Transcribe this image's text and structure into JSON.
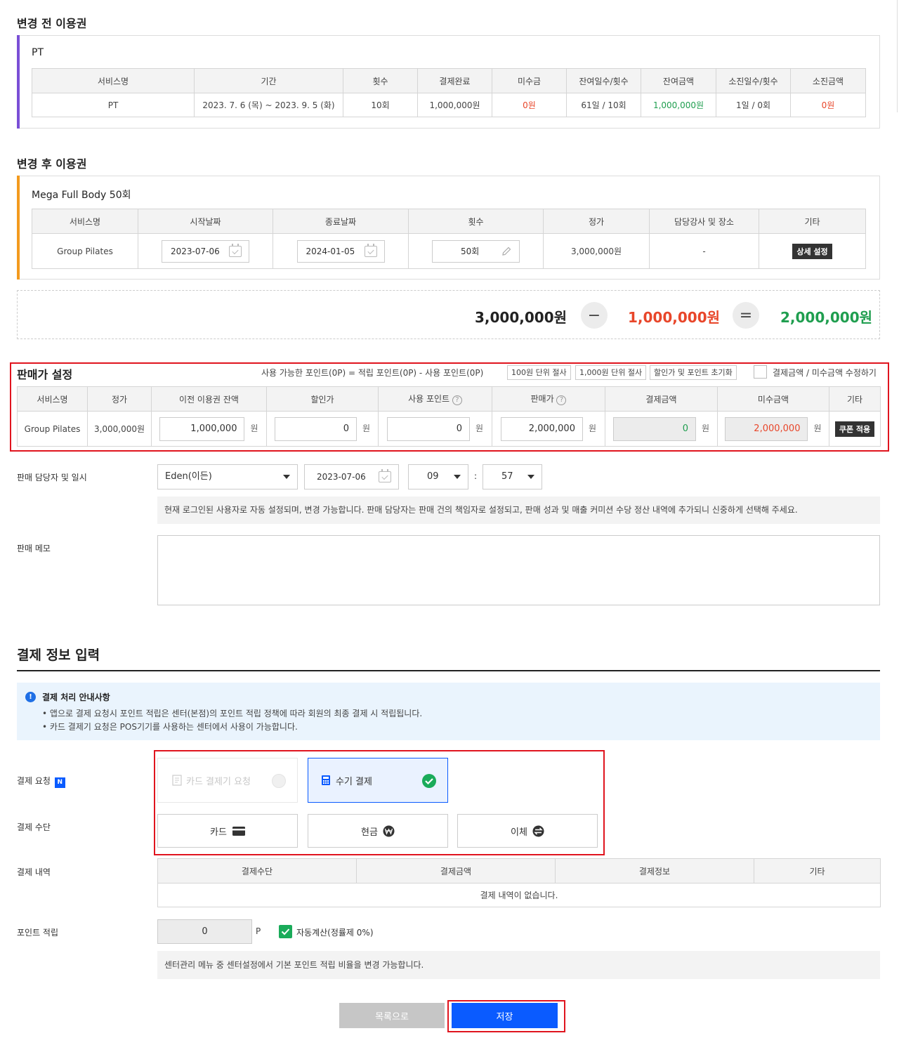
{
  "before": {
    "title": "변경 전 이용권",
    "plan_name": "PT",
    "headers": [
      "서비스명",
      "기간",
      "횟수",
      "결제완료",
      "미수금",
      "잔여일수/횟수",
      "잔여금액",
      "소진일수/횟수",
      "소진금액"
    ],
    "row": [
      "PT",
      "2023. 7. 6 (목) ~ 2023. 9. 5 (화)",
      "10회",
      "1,000,000원",
      "0원",
      "61일 / 10회",
      "1,000,000원",
      "1일 / 0회",
      "0원"
    ],
    "accent": "#7a4fd6"
  },
  "after": {
    "title": "변경 후 이용권",
    "plan_name": "Mega Full Body 50회",
    "headers": [
      "서비스명",
      "시작날짜",
      "종료날짜",
      "횟수",
      "정가",
      "담당강사 및 장소",
      "기타"
    ],
    "service": "Group Pilates",
    "start_date": "2023-07-06",
    "end_date": "2024-01-05",
    "count": "50회",
    "price": "3,000,000원",
    "instructor": "-",
    "detail_button": "상세 설정",
    "accent": "#f39a1e"
  },
  "calc": {
    "price": "3,000,000원",
    "minus": "−",
    "deduct": "1,000,000원",
    "equals": "=",
    "result": "2,000,000원"
  },
  "sale": {
    "title": "판매가 설정",
    "points_info": "사용 가능한 포인트(0P) = 적립 포인트(0P) - 사용 포인트(0P)",
    "btn_100": "100원 단위 절사",
    "btn_1000": "1,000원 단위 절사",
    "btn_reset": "할인가 및 포인트 초기화",
    "edit_label": "결제금액 / 미수금액 수정하기",
    "headers": [
      "서비스명",
      "정가",
      "이전 이용권 잔액",
      "할인가",
      "사용 포인트",
      "판매가",
      "결제금액",
      "미수금액",
      "기타"
    ],
    "service": "Group Pilates",
    "price": "3,000,000원",
    "prev_balance": "1,000,000",
    "discount": "0",
    "use_points": "0",
    "sale_price": "2,000,000",
    "pay_amount": "0",
    "unpaid": "2,000,000",
    "unit": "원",
    "coupon_button": "쿠폰 적용"
  },
  "seller": {
    "label": "판매 담당자 및 일시",
    "name": "Eden(이든)",
    "date": "2023-07-06",
    "hour": "09",
    "colon": ":",
    "minute": "57",
    "hint": "현재 로그인된 사용자로 자동 설정되며, 변경 가능합니다. 판매 담당자는 판매 건의 책임자로 설정되고, 판매 성과 및 매출 커미션 수당 정산 내역에 추가되니 신중하게 선택해 주세요."
  },
  "memo": {
    "label": "판매 메모",
    "value": ""
  },
  "payment": {
    "title": "결제 정보 입력",
    "notice_title": "결제 처리 안내사항",
    "notice_lines": [
      "앱으로 결제 요청시 포인트 적립은 센터(본점)의 포인트 적립 정책에 따라 회원의 최종 결제 시 적립됩니다.",
      "카드 결제기 요청은 POS기기를 사용하는 센터에서 사용이 가능합니다."
    ],
    "request_label": "결제 요청",
    "new_badge": "N",
    "card_request": "카드 결제기 요청",
    "manual_pay": "수기 결제",
    "method_label": "결제 수단",
    "methods": [
      "카드",
      "현금",
      "이체"
    ],
    "history_label": "결제 내역",
    "history_headers": [
      "결제수단",
      "결제금액",
      "결제정보",
      "기타"
    ],
    "history_empty": "결제 내역이 없습니다.",
    "points_label": "포인트 적립",
    "points_value": "0",
    "points_unit": "P",
    "auto_calc": "자동계산(정률제 0%)",
    "points_hint": "센터관리 메뉴 중 센터설정에서 기본 포인트 적립 비율을 변경 가능합니다."
  },
  "footer": {
    "list_button": "목록으로",
    "save_button": "저장"
  },
  "colors": {
    "primary": "#0a5bff",
    "red": "#e8462a",
    "green": "#1f9e4f",
    "highlight": "#e0141e"
  }
}
